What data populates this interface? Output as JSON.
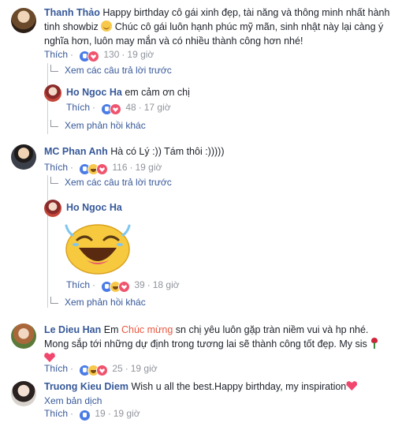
{
  "comments": [
    {
      "author": "Thanh Thảo",
      "text_before_emoji": "Happy birthday cô gái xinh đẹp, tài năng và thông minh nhất hành tinh showbiz",
      "text_after_emoji": "Chúc cô gái luôn hạnh phúc mỹ mãn, sinh nhật này lại càng ý nghĩa hơn, luôn may mắn và có nhiều thành công hơn nhé!",
      "like_label": "Thích",
      "reaction_count": "130",
      "time": "19 giờ",
      "reactions": [
        "like",
        "love"
      ]
    },
    {
      "author": "MC Phan Anh",
      "text": "Hà có Lý :)) Tám thôi :)))))",
      "like_label": "Thích",
      "reaction_count": "116",
      "time": "19 giờ",
      "reactions": [
        "like",
        "haha",
        "love"
      ]
    },
    {
      "author": "Le Dieu Han",
      "text_prefix": "Em",
      "highlight": "Chúc mừng",
      "text_rest": "sn chị yêu luôn gặp tràn niềm vui và hp nhé. Mong sắp tới những dự định trong tương lai sẽ thành công tốt đẹp. My sis",
      "like_label": "Thích",
      "reaction_count": "25",
      "time": "19 giờ",
      "reactions": [
        "like",
        "haha",
        "love"
      ]
    },
    {
      "author": "Truong Kieu Diem",
      "text": "Wish u all the best.Happy birthday, my inspiration",
      "translate_label": "Xem bản dịch",
      "like_label": "Thích",
      "reaction_count": "19",
      "time": "19 giờ",
      "reactions": [
        "like"
      ]
    }
  ],
  "replies": [
    {
      "previous_label": "Xem các câu trả lời trước",
      "author": "Ho Ngoc Ha",
      "text": "em cảm ơn chị",
      "like_label": "Thích",
      "reaction_count": "48",
      "time": "17 giờ",
      "more_label": "Xem phản hồi khác",
      "reactions": [
        "like",
        "love"
      ]
    },
    {
      "previous_label": "Xem các câu trả lời trước",
      "author": "Ho Ngoc Ha",
      "sticker": "laughing-face-sticker",
      "like_label": "Thích",
      "reaction_count": "39",
      "time": "18 giờ",
      "more_label": "Xem phản hồi khác",
      "reactions": [
        "like",
        "haha",
        "love"
      ]
    }
  ],
  "colors": {
    "name_blue": "#365899",
    "meta_gray": "#90949c",
    "highlight_orange": "#e9573f",
    "heart_pink": "#f1476e"
  }
}
